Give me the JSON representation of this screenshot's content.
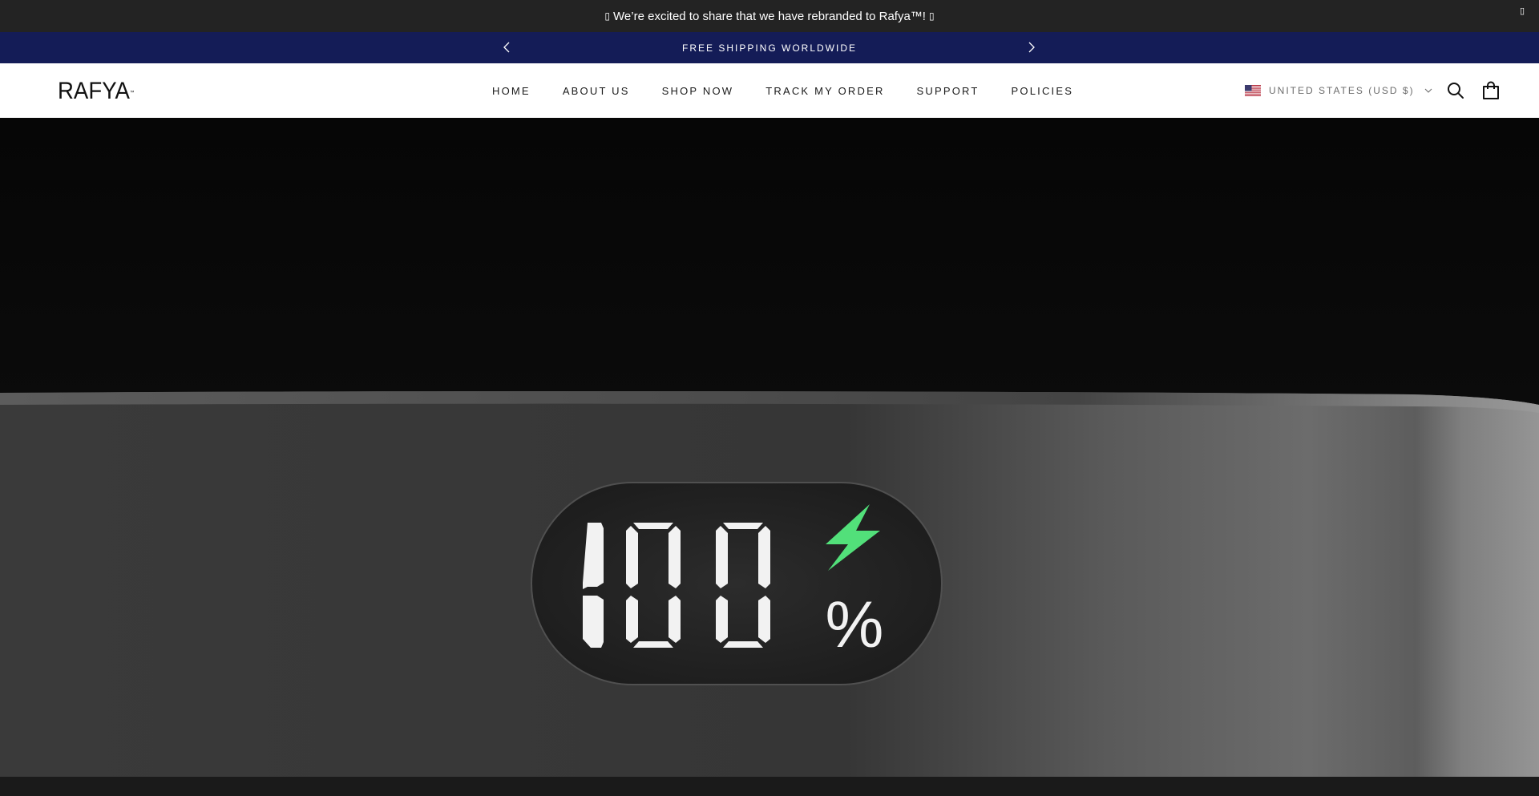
{
  "announcement": {
    "text": "We’re excited to share that we have rebranded to Rafya™!",
    "close_icon": "close-icon"
  },
  "shipping_bar": {
    "message": "FREE SHIPPING WORLDWIDE",
    "prev_icon": "chevron-left-icon",
    "next_icon": "chevron-right-icon",
    "background": "#141c57"
  },
  "header": {
    "logo_text": "RAFYA",
    "logo_mark": "™",
    "nav": [
      {
        "label": "HOME"
      },
      {
        "label": "ABOUT US"
      },
      {
        "label": "SHOP NOW"
      },
      {
        "label": "TRACK MY ORDER"
      },
      {
        "label": "SUPPORT"
      },
      {
        "label": "POLICIES"
      }
    ],
    "locale": {
      "label": "UNITED STATES (USD $)",
      "flag_icon": "us-flag-icon"
    },
    "search_icon": "search-icon",
    "cart_icon": "shopping-bag-icon"
  },
  "hero": {
    "display_value": "100",
    "display_unit": "%",
    "bolt_icon": "lightning-bolt-icon",
    "bolt_color": "#52e07a"
  }
}
